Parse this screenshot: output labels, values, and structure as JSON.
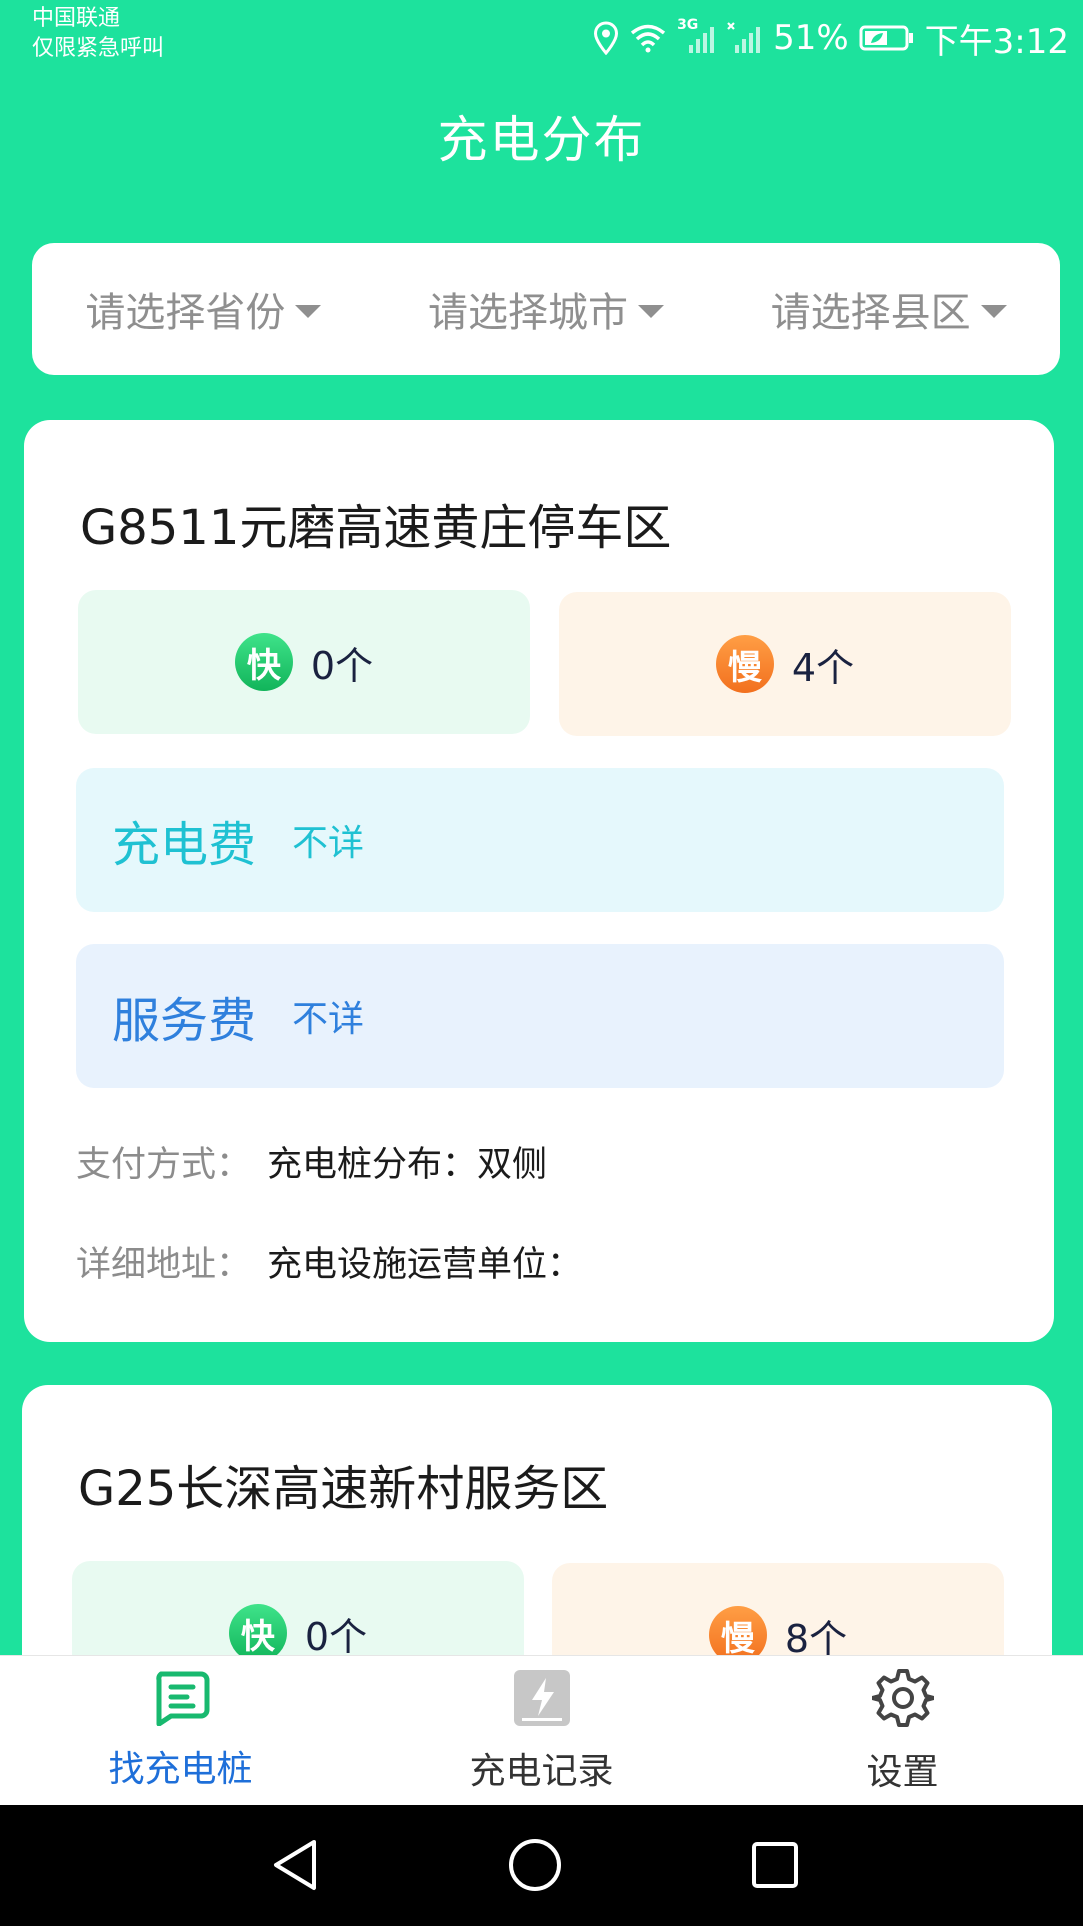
{
  "status_bar": {
    "carrier_line1": "中国联通",
    "carrier_line2": "仅限紧急呼叫",
    "network_label": "3G",
    "battery_percent": "51%",
    "time": "下午3:12",
    "icons": [
      "location-icon",
      "wifi-icon",
      "signal-icon",
      "signal-off-icon",
      "battery-icon"
    ]
  },
  "header": {
    "title": "充电分布"
  },
  "filters": [
    {
      "placeholder": "请选择省份"
    },
    {
      "placeholder": "请选择城市"
    },
    {
      "placeholder": "请选择县区"
    }
  ],
  "stations": [
    {
      "name": "G8511元磨高速黄庄停车区",
      "fast_badge": "快",
      "fast_count": "0个",
      "slow_badge": "慢",
      "slow_count": "4个",
      "charge_fee_label": "充电费",
      "charge_fee_value": "不详",
      "service_fee_label": "服务费",
      "service_fee_value": "不详",
      "payment_key": "支付方式：",
      "payment_value": "充电桩分布：双侧",
      "address_key": "详细地址：",
      "address_value": "充电设施运营单位："
    },
    {
      "name": "G25长深高速新村服务区",
      "fast_badge": "快",
      "fast_count": "0个",
      "slow_badge": "慢",
      "slow_count": "8个"
    }
  ],
  "tabs": [
    {
      "label": "找充电桩",
      "icon": "charger-list-icon",
      "active": true
    },
    {
      "label": "充电记录",
      "icon": "charge-record-icon",
      "active": false
    },
    {
      "label": "设置",
      "icon": "gear-icon",
      "active": false
    }
  ],
  "colors": {
    "primary_green": "#1de29d",
    "active_tab": "#1e6fd9",
    "fast_badge": "#1fc36a",
    "slow_badge": "#f57f28",
    "charge_fee": "#1fc1d2",
    "service_fee": "#2f80dd"
  }
}
